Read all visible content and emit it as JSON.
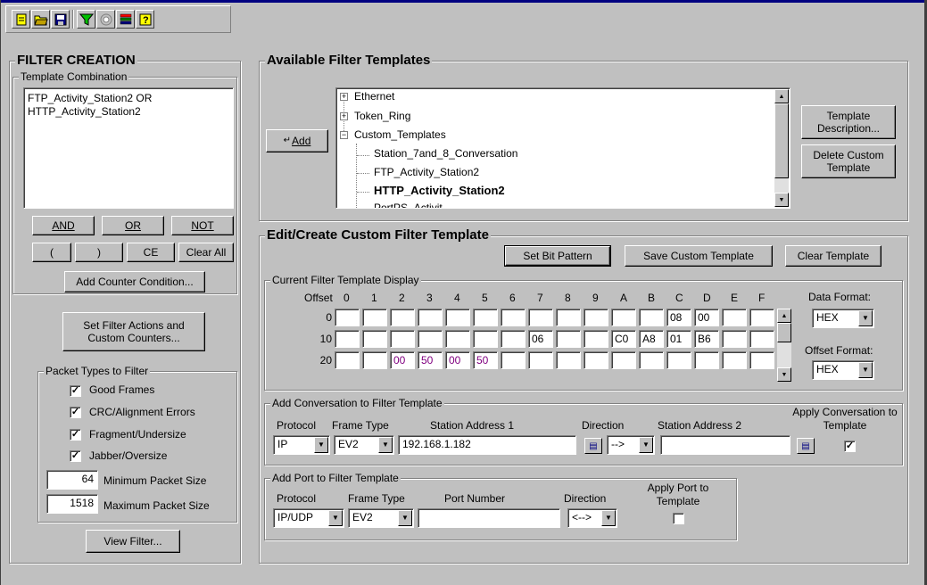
{
  "toolbar": {
    "icons": [
      "new-icon",
      "open-folder-icon",
      "save-icon",
      "filter-funnel-icon",
      "counter-icon",
      "list-icon",
      "help-icon"
    ]
  },
  "filter_creation": {
    "title": "FILTER CREATION",
    "template_combination": {
      "label": "Template Combination",
      "lines": [
        "FTP_Activity_Station2 OR",
        "HTTP_Activity_Station2"
      ]
    },
    "buttons": {
      "and": "AND",
      "or": "OR",
      "not": "NOT",
      "lparen": "(",
      "rparen": ")",
      "ce": "CE",
      "clear_all": "Clear All",
      "add_counter": "Add Counter Condition..."
    },
    "set_actions": "Set Filter Actions and Custom Counters...",
    "packet_types": {
      "label": "Packet Types to Filter",
      "items": [
        {
          "label": "Good Frames",
          "checked": true
        },
        {
          "label": "CRC/Alignment Errors",
          "checked": true
        },
        {
          "label": "Fragment/Undersize",
          "checked": true
        },
        {
          "label": "Jabber/Oversize",
          "checked": true
        }
      ],
      "min_size": {
        "value": "64",
        "label": "Minimum Packet Size"
      },
      "max_size": {
        "value": "1518",
        "label": "Maximum Packet Size"
      }
    },
    "view_filter": "View Filter..."
  },
  "available_templates": {
    "title": "Available Filter Templates",
    "add_button": "Add",
    "tree": [
      {
        "label": "Ethernet",
        "level": 0,
        "expander": "+"
      },
      {
        "label": "Token_Ring",
        "level": 0,
        "expander": "+"
      },
      {
        "label": "Custom_Templates",
        "level": 0,
        "expander": "-"
      },
      {
        "label": "Station_7and_8_Conversation",
        "level": 1
      },
      {
        "label": "FTP_Activity_Station2",
        "level": 1
      },
      {
        "label": "HTTP_Activity_Station2",
        "level": 1,
        "bold": true
      },
      {
        "label": "PortPS_Activit",
        "level": 1
      }
    ],
    "template_description": "Template Description...",
    "delete_custom": "Delete Custom Template"
  },
  "edit_template": {
    "title": "Edit/Create Custom Filter Template",
    "set_bit_pattern": "Set Bit Pattern",
    "save_custom": "Save Custom Template",
    "clear_template": "Clear Template",
    "display": {
      "label": "Current Filter Template Display",
      "offset_label": "Offset",
      "columns": [
        "0",
        "1",
        "2",
        "3",
        "4",
        "5",
        "6",
        "7",
        "8",
        "9",
        "A",
        "B",
        "C",
        "D",
        "E",
        "F"
      ],
      "rows": [
        {
          "offset": "0",
          "cells": [
            "",
            "",
            "",
            "",
            "",
            "",
            "",
            "",
            "",
            "",
            "",
            "",
            "08",
            "00",
            "",
            ""
          ]
        },
        {
          "offset": "10",
          "cells": [
            "",
            "",
            "",
            "",
            "",
            "",
            "",
            "06",
            "",
            "",
            "C0",
            "A8",
            "01",
            "B6",
            "",
            ""
          ]
        },
        {
          "offset": "20",
          "cells": [
            "",
            "",
            "00",
            "50",
            "00",
            "50",
            "",
            "",
            "",
            "",
            "",
            "",
            "",
            "",
            "",
            ""
          ]
        }
      ],
      "highlight_color": "#800080",
      "data_format_label": "Data Format:",
      "data_format": "HEX",
      "offset_format_label": "Offset Format:",
      "offset_format": "HEX"
    },
    "conversation": {
      "label": "Add Conversation to Filter Template",
      "protocol_label": "Protocol",
      "protocol": "IP",
      "frame_type_label": "Frame Type",
      "frame_type": "EV2",
      "station1_label": "Station Address 1",
      "station1": "192.168.1.182",
      "direction_label": "Direction",
      "direction": "-->",
      "station2_label": "Station Address 2",
      "station2": "",
      "apply_label": "Apply Conversation to Template",
      "apply_checked": true
    },
    "port": {
      "label": "Add Port to Filter Template",
      "protocol_label": "Protocol",
      "protocol": "IP/UDP",
      "frame_type_label": "Frame Type",
      "frame_type": "EV2",
      "port_label": "Port Number",
      "port": "",
      "direction_label": "Direction",
      "direction": "<-->",
      "apply_label": "Apply Port to Template",
      "apply_checked": false
    }
  }
}
